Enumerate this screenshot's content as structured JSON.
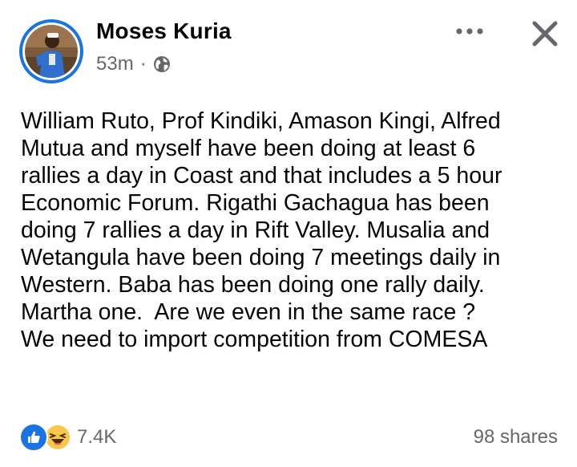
{
  "post": {
    "author": "Moses Kuria",
    "time": "53m",
    "separator": "·",
    "audience_icon": "globe-icon",
    "text": "William Ruto, Prof Kindiki, Amason Kingi, Alfred\nMutua and myself have been doing at least 6\nrallies a day in Coast and that includes a 5 hour\nEconomic Forum. Rigathi Gachagua has been\ndoing 7 rallies a day in Rift Valley. Musalia and\nWetangula have been doing 7 meetings daily in\nWestern. Baba has been doing one rally daily.\nMartha one.  Are we even in the same race ?\nWe need to import competition from COMESA"
  },
  "header_actions": {
    "more_icon": "more-dots-icon",
    "close_icon": "close-icon"
  },
  "footer": {
    "reactions": [
      "like-icon",
      "haha-icon"
    ],
    "reaction_count": "7.4K",
    "shares": "98 shares"
  },
  "colors": {
    "accent": "#1b74e4",
    "secondary_text": "#65676b",
    "primary_text": "#050505"
  }
}
